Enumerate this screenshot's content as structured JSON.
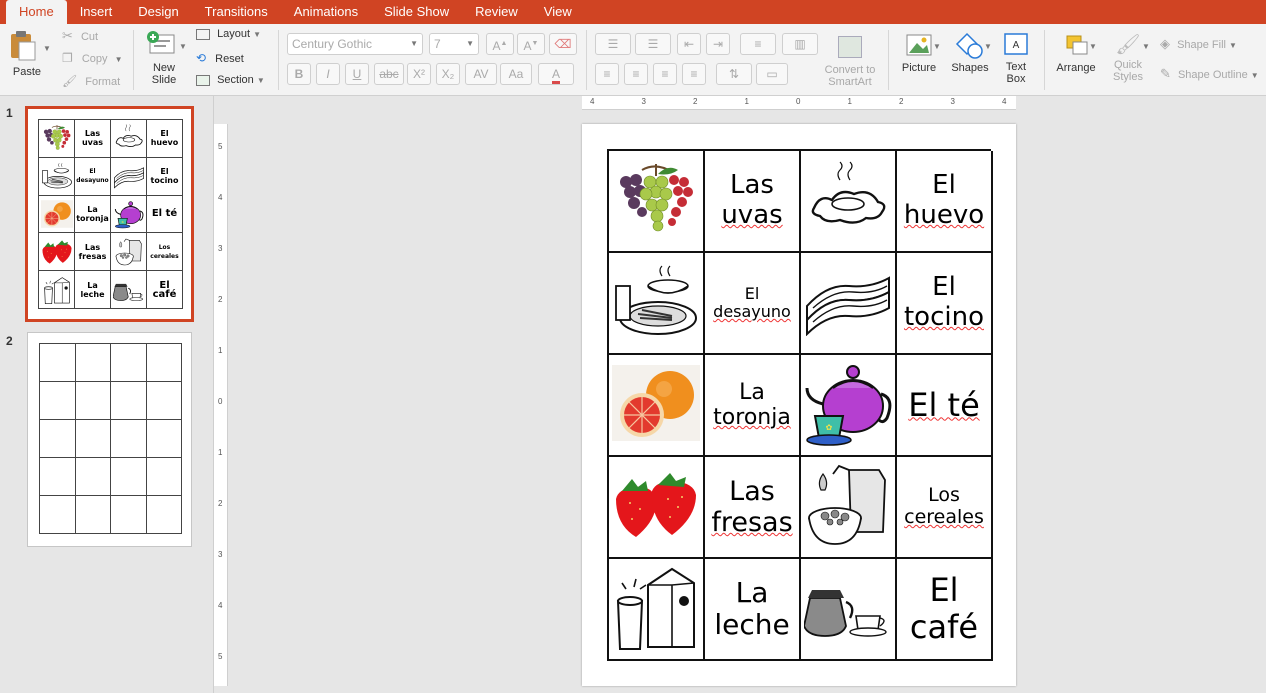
{
  "tabs": [
    "Home",
    "Insert",
    "Design",
    "Transitions",
    "Animations",
    "Slide Show",
    "Review",
    "View"
  ],
  "ribbon": {
    "paste": "Paste",
    "cut": "Cut",
    "copy": "Copy",
    "format": "Format",
    "new_slide_1": "New",
    "new_slide_2": "Slide",
    "layout": "Layout",
    "reset": "Reset",
    "section": "Section",
    "font_name": "Century Gothic",
    "font_size": "7",
    "convert_1": "Convert to",
    "convert_2": "SmartArt",
    "picture": "Picture",
    "shapes": "Shapes",
    "textbox_1": "Text",
    "textbox_2": "Box",
    "arrange": "Arrange",
    "quick_1": "Quick",
    "quick_2": "Styles",
    "shape_fill": "Shape Fill",
    "shape_outline": "Shape Outline"
  },
  "format_buttons": {
    "bold": "B",
    "italic": "I",
    "underline": "U",
    "strike": "abc",
    "superscript": "X²",
    "subscript": "X₂",
    "grow": "A",
    "shrink": "A"
  },
  "slides": [
    {
      "number": "1"
    },
    {
      "number": "2"
    }
  ],
  "ruler": {
    "h": [
      "4",
      "3",
      "2",
      "1",
      "0",
      "1",
      "2",
      "3",
      "4"
    ],
    "v": [
      "5",
      "4",
      "3",
      "2",
      "1",
      "0",
      "1",
      "2",
      "3",
      "4",
      "5"
    ]
  },
  "cards": [
    {
      "label": "",
      "image": "grapes"
    },
    {
      "label1": "Las",
      "label2": "uvas",
      "size": 26
    },
    {
      "label": "",
      "image": "egg"
    },
    {
      "label1": "El",
      "label2": "huevo",
      "size": 26
    },
    {
      "label": "",
      "image": "breakfast"
    },
    {
      "label1": "El",
      "label2": "desayuno",
      "size": 16
    },
    {
      "label": "",
      "image": "bacon"
    },
    {
      "label1": "El",
      "label2": "tocino",
      "size": 26
    },
    {
      "label": "",
      "image": "grapefruit"
    },
    {
      "label1": "La",
      "label2": "toronja",
      "size": 22
    },
    {
      "label": "",
      "image": "teapot"
    },
    {
      "label1": "El té",
      "label2": "",
      "size": 32
    },
    {
      "label": "",
      "image": "strawberries"
    },
    {
      "label1": "Las",
      "label2": "fresas",
      "size": 27
    },
    {
      "label": "",
      "image": "cereal"
    },
    {
      "label1": "Los",
      "label2": "cereales",
      "size": 19
    },
    {
      "label": "",
      "image": "milk"
    },
    {
      "label1": "La",
      "label2": "leche",
      "size": 28
    },
    {
      "label": "",
      "image": "coffee"
    },
    {
      "label1": "El",
      "label2": "café",
      "size": 32
    }
  ]
}
